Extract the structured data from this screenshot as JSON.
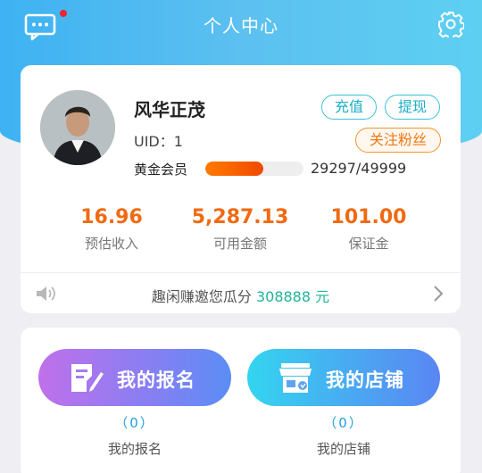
{
  "header": {
    "title": "个人中心"
  },
  "profile": {
    "name": "风华正茂",
    "uid": "UID：1",
    "member_level": "黄金会员",
    "progress_fraction": 0.593,
    "progress_text": "29297/49999",
    "buttons": {
      "recharge": "充值",
      "withdraw": "提现",
      "follow": "关注粉丝"
    }
  },
  "stats": [
    {
      "value": "16.96",
      "label": "预估收入"
    },
    {
      "value": "5,287.13",
      "label": "可用金额"
    },
    {
      "value": "101.00",
      "label": "保证金"
    }
  ],
  "notice": {
    "text": "趣闲赚邀您瓜分 ",
    "highlight": "308888 元"
  },
  "actions": {
    "signup": {
      "label": "我的报名",
      "count": "（0）",
      "caption": "我的报名"
    },
    "shop": {
      "label": "我的店铺",
      "count": "（0）",
      "caption": "我的店铺"
    }
  },
  "colors": {
    "accent_orange": "#f06a12",
    "teal": "#1aaec6",
    "header_blue": "#3eb2f2"
  },
  "icons": [
    "chat-icon",
    "gear-icon",
    "speaker-icon",
    "chevron-right-icon",
    "edit-form-icon",
    "store-icon"
  ]
}
